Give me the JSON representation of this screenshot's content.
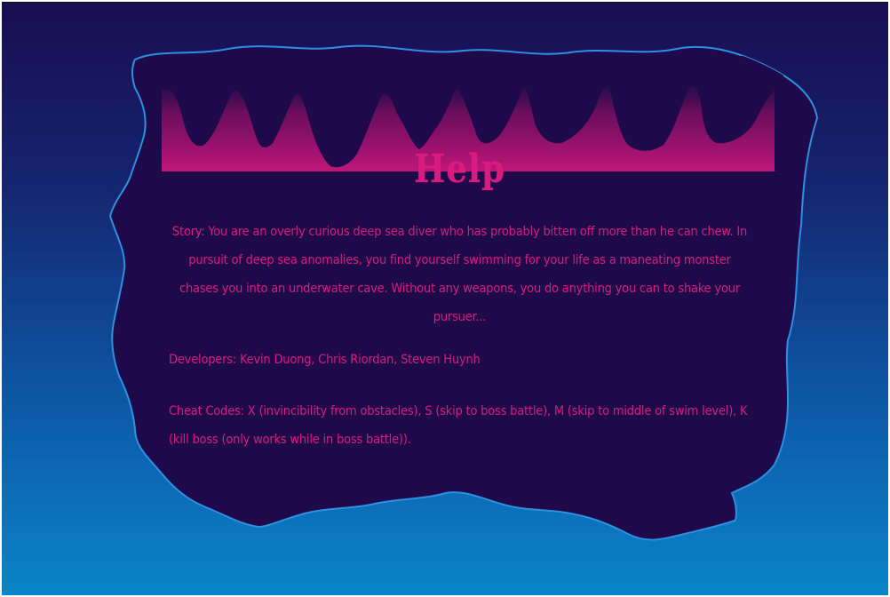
{
  "help": {
    "title": "Help",
    "story": "Story: You are an overly curious deep sea diver who has probably bitten off more than he can chew. In pursuit of deep sea anomalies, you find yourself swimming for your life as a maneating monster chases you into an underwater cave. Without any weapons, you do anything you can to shake your pursuer...",
    "developers": "Developers: Kevin Duong, Chris Riordan, Steven Huynh",
    "cheat_codes": "Cheat Codes: X (invincibility from obstacles), S (skip to boss battle), M (skip to middle of swim level), K (kill boss (only works while in boss battle))."
  },
  "colors": {
    "text_accent": "#d81b7e",
    "panel_fill": "#1e0a4a",
    "panel_outline": "#2f8fe0",
    "stalactite_glow": "#b0156f"
  }
}
